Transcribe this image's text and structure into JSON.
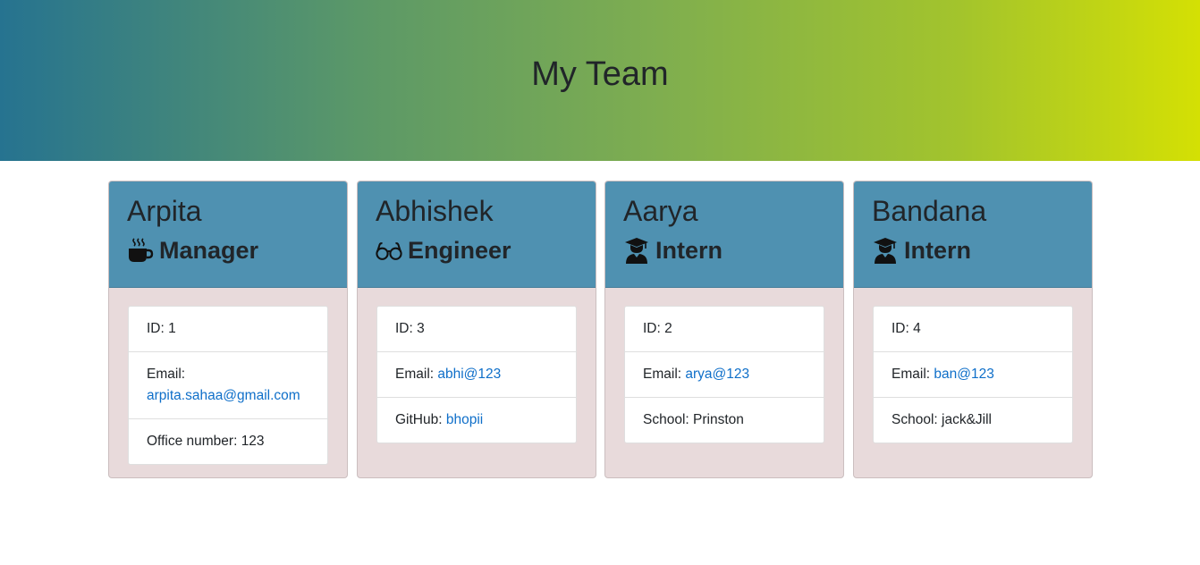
{
  "header": {
    "title": "My Team"
  },
  "team": [
    {
      "name": "Arpita",
      "role": "Manager",
      "icon": "coffee-icon",
      "details": [
        {
          "label": "ID: ",
          "value": "1",
          "link": false
        },
        {
          "label": "Email: ",
          "value": "arpita.sahaa@gmail.com",
          "link": true
        },
        {
          "label": "Office number: ",
          "value": "123",
          "link": false
        }
      ]
    },
    {
      "name": "Abhishek",
      "role": "Engineer",
      "icon": "glasses-icon",
      "details": [
        {
          "label": "ID: ",
          "value": "3",
          "link": false
        },
        {
          "label": "Email: ",
          "value": "abhi@123",
          "link": true
        },
        {
          "label": "GitHub: ",
          "value": "bhopii",
          "link": true
        }
      ]
    },
    {
      "name": "Aarya",
      "role": "Intern",
      "icon": "graduate-icon",
      "details": [
        {
          "label": "ID: ",
          "value": "2",
          "link": false
        },
        {
          "label": "Email: ",
          "value": "arya@123",
          "link": true
        },
        {
          "label": "School: ",
          "value": "Prinston",
          "link": false
        }
      ]
    },
    {
      "name": "Bandana",
      "role": "Intern",
      "icon": "graduate-icon",
      "details": [
        {
          "label": "ID: ",
          "value": "4",
          "link": false
        },
        {
          "label": "Email: ",
          "value": "ban@123",
          "link": true
        },
        {
          "label": "School: ",
          "value": "jack&Jill",
          "link": false
        }
      ]
    }
  ],
  "colors": {
    "card_header": "#4f91b1",
    "card_body": "#e8dadb",
    "link": "#0f6fc9"
  }
}
